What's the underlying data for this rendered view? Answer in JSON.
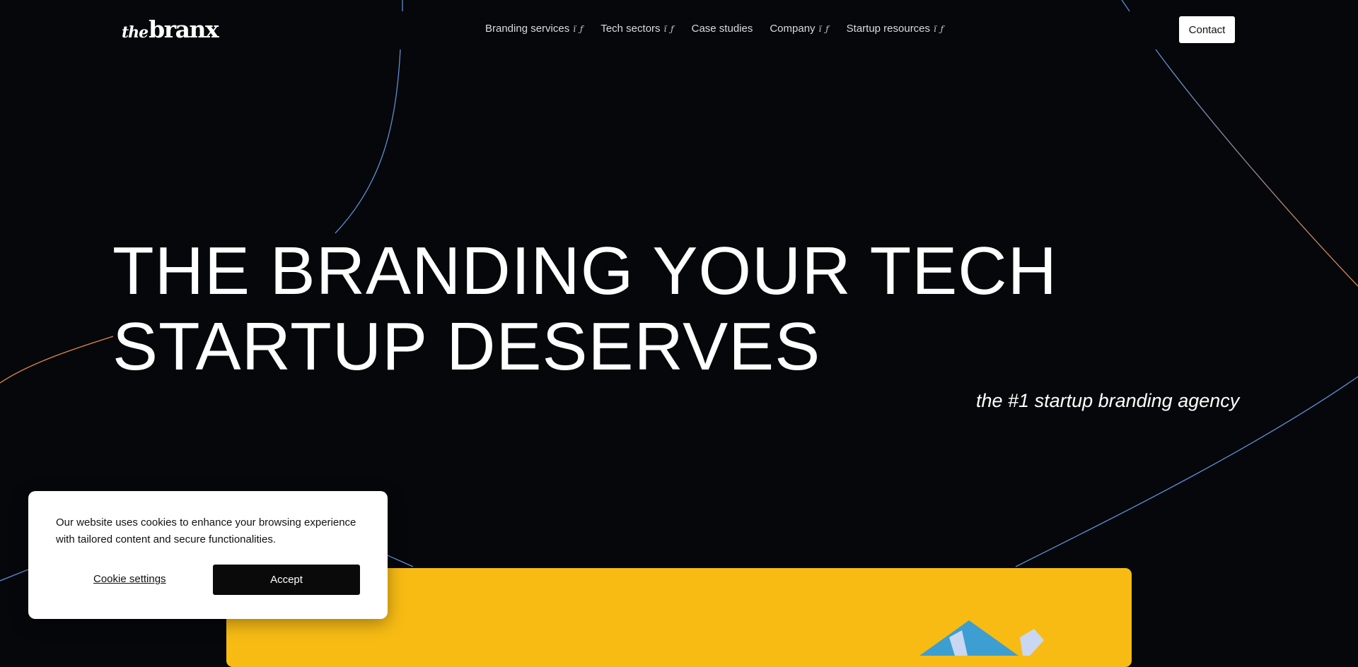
{
  "header": {
    "logo_small": "the",
    "logo_main": "branx",
    "nav": [
      {
        "label": "Branding services",
        "icon": "chevron-down-icon"
      },
      {
        "label": "Tech sectors",
        "icon": "chevron-down-icon"
      },
      {
        "label": "Case studies"
      },
      {
        "label": "Company",
        "icon": "chevron-down-icon"
      },
      {
        "label": "Startup resources",
        "icon": "chevron-down-icon"
      }
    ],
    "caret_glyph": "ï ƒ",
    "contact_label": "Contact"
  },
  "hero": {
    "title_line1": "THE BRANDING YOUR TECH",
    "title_line2": "STARTUP DESERVES",
    "tagline": "the #1 startup branding agency"
  },
  "cookie_banner": {
    "text": "Our website uses cookies to enhance your browsing experience with tailored content and secure functionalities.",
    "settings_label": "Cookie settings",
    "accept_label": "Accept"
  },
  "colors": {
    "background": "#06070a",
    "line_blue": "#5b8fd6",
    "line_orange": "#e2874a",
    "card_yellow": "#f7bb14",
    "art_blue": "#3d9ed1",
    "art_light": "#c9d7f2"
  }
}
